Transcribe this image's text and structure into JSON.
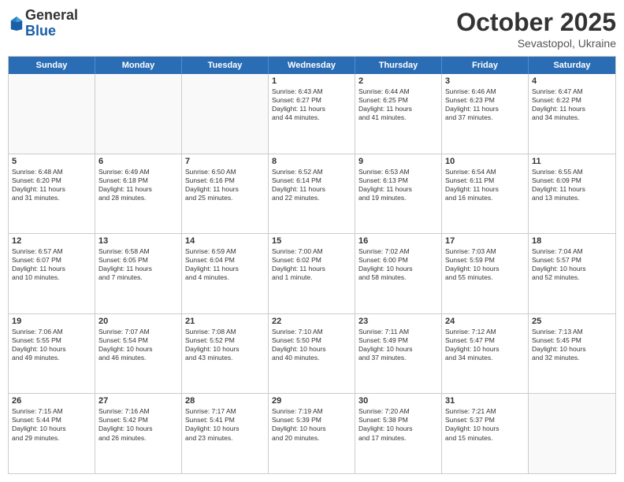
{
  "header": {
    "logo_general": "General",
    "logo_blue": "Blue",
    "title": "October 2025",
    "subtitle": "Sevastopol, Ukraine"
  },
  "weekdays": [
    "Sunday",
    "Monday",
    "Tuesday",
    "Wednesday",
    "Thursday",
    "Friday",
    "Saturday"
  ],
  "weeks": [
    [
      {
        "day": "",
        "empty": true
      },
      {
        "day": "",
        "empty": true
      },
      {
        "day": "",
        "empty": true
      },
      {
        "day": "1",
        "lines": [
          "Sunrise: 6:43 AM",
          "Sunset: 6:27 PM",
          "Daylight: 11 hours",
          "and 44 minutes."
        ]
      },
      {
        "day": "2",
        "lines": [
          "Sunrise: 6:44 AM",
          "Sunset: 6:25 PM",
          "Daylight: 11 hours",
          "and 41 minutes."
        ]
      },
      {
        "day": "3",
        "lines": [
          "Sunrise: 6:46 AM",
          "Sunset: 6:23 PM",
          "Daylight: 11 hours",
          "and 37 minutes."
        ]
      },
      {
        "day": "4",
        "lines": [
          "Sunrise: 6:47 AM",
          "Sunset: 6:22 PM",
          "Daylight: 11 hours",
          "and 34 minutes."
        ]
      }
    ],
    [
      {
        "day": "5",
        "lines": [
          "Sunrise: 6:48 AM",
          "Sunset: 6:20 PM",
          "Daylight: 11 hours",
          "and 31 minutes."
        ]
      },
      {
        "day": "6",
        "lines": [
          "Sunrise: 6:49 AM",
          "Sunset: 6:18 PM",
          "Daylight: 11 hours",
          "and 28 minutes."
        ]
      },
      {
        "day": "7",
        "lines": [
          "Sunrise: 6:50 AM",
          "Sunset: 6:16 PM",
          "Daylight: 11 hours",
          "and 25 minutes."
        ]
      },
      {
        "day": "8",
        "lines": [
          "Sunrise: 6:52 AM",
          "Sunset: 6:14 PM",
          "Daylight: 11 hours",
          "and 22 minutes."
        ]
      },
      {
        "day": "9",
        "lines": [
          "Sunrise: 6:53 AM",
          "Sunset: 6:13 PM",
          "Daylight: 11 hours",
          "and 19 minutes."
        ]
      },
      {
        "day": "10",
        "lines": [
          "Sunrise: 6:54 AM",
          "Sunset: 6:11 PM",
          "Daylight: 11 hours",
          "and 16 minutes."
        ]
      },
      {
        "day": "11",
        "lines": [
          "Sunrise: 6:55 AM",
          "Sunset: 6:09 PM",
          "Daylight: 11 hours",
          "and 13 minutes."
        ]
      }
    ],
    [
      {
        "day": "12",
        "lines": [
          "Sunrise: 6:57 AM",
          "Sunset: 6:07 PM",
          "Daylight: 11 hours",
          "and 10 minutes."
        ]
      },
      {
        "day": "13",
        "lines": [
          "Sunrise: 6:58 AM",
          "Sunset: 6:05 PM",
          "Daylight: 11 hours",
          "and 7 minutes."
        ]
      },
      {
        "day": "14",
        "lines": [
          "Sunrise: 6:59 AM",
          "Sunset: 6:04 PM",
          "Daylight: 11 hours",
          "and 4 minutes."
        ]
      },
      {
        "day": "15",
        "lines": [
          "Sunrise: 7:00 AM",
          "Sunset: 6:02 PM",
          "Daylight: 11 hours",
          "and 1 minute."
        ]
      },
      {
        "day": "16",
        "lines": [
          "Sunrise: 7:02 AM",
          "Sunset: 6:00 PM",
          "Daylight: 10 hours",
          "and 58 minutes."
        ]
      },
      {
        "day": "17",
        "lines": [
          "Sunrise: 7:03 AM",
          "Sunset: 5:59 PM",
          "Daylight: 10 hours",
          "and 55 minutes."
        ]
      },
      {
        "day": "18",
        "lines": [
          "Sunrise: 7:04 AM",
          "Sunset: 5:57 PM",
          "Daylight: 10 hours",
          "and 52 minutes."
        ]
      }
    ],
    [
      {
        "day": "19",
        "lines": [
          "Sunrise: 7:06 AM",
          "Sunset: 5:55 PM",
          "Daylight: 10 hours",
          "and 49 minutes."
        ]
      },
      {
        "day": "20",
        "lines": [
          "Sunrise: 7:07 AM",
          "Sunset: 5:54 PM",
          "Daylight: 10 hours",
          "and 46 minutes."
        ]
      },
      {
        "day": "21",
        "lines": [
          "Sunrise: 7:08 AM",
          "Sunset: 5:52 PM",
          "Daylight: 10 hours",
          "and 43 minutes."
        ]
      },
      {
        "day": "22",
        "lines": [
          "Sunrise: 7:10 AM",
          "Sunset: 5:50 PM",
          "Daylight: 10 hours",
          "and 40 minutes."
        ]
      },
      {
        "day": "23",
        "lines": [
          "Sunrise: 7:11 AM",
          "Sunset: 5:49 PM",
          "Daylight: 10 hours",
          "and 37 minutes."
        ]
      },
      {
        "day": "24",
        "lines": [
          "Sunrise: 7:12 AM",
          "Sunset: 5:47 PM",
          "Daylight: 10 hours",
          "and 34 minutes."
        ]
      },
      {
        "day": "25",
        "lines": [
          "Sunrise: 7:13 AM",
          "Sunset: 5:45 PM",
          "Daylight: 10 hours",
          "and 32 minutes."
        ]
      }
    ],
    [
      {
        "day": "26",
        "lines": [
          "Sunrise: 7:15 AM",
          "Sunset: 5:44 PM",
          "Daylight: 10 hours",
          "and 29 minutes."
        ]
      },
      {
        "day": "27",
        "lines": [
          "Sunrise: 7:16 AM",
          "Sunset: 5:42 PM",
          "Daylight: 10 hours",
          "and 26 minutes."
        ]
      },
      {
        "day": "28",
        "lines": [
          "Sunrise: 7:17 AM",
          "Sunset: 5:41 PM",
          "Daylight: 10 hours",
          "and 23 minutes."
        ]
      },
      {
        "day": "29",
        "lines": [
          "Sunrise: 7:19 AM",
          "Sunset: 5:39 PM",
          "Daylight: 10 hours",
          "and 20 minutes."
        ]
      },
      {
        "day": "30",
        "lines": [
          "Sunrise: 7:20 AM",
          "Sunset: 5:38 PM",
          "Daylight: 10 hours",
          "and 17 minutes."
        ]
      },
      {
        "day": "31",
        "lines": [
          "Sunrise: 7:21 AM",
          "Sunset: 5:37 PM",
          "Daylight: 10 hours",
          "and 15 minutes."
        ]
      },
      {
        "day": "",
        "empty": true
      }
    ]
  ]
}
